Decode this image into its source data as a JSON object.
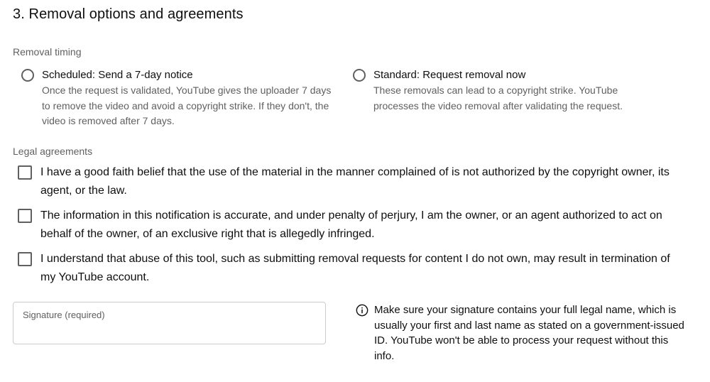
{
  "section": {
    "title": "3. Removal options and agreements"
  },
  "removal_timing": {
    "label": "Removal timing",
    "options": [
      {
        "title": "Scheduled: Send a 7-day notice",
        "description": "Once the request is validated, YouTube gives the uploader 7 days to remove the video and avoid a copyright strike. If they don't, the video is removed after 7 days.",
        "selected": false
      },
      {
        "title": "Standard: Request removal now",
        "description": "These removals can lead to a copyright strike. YouTube processes the video removal after validating the request.",
        "selected": false
      }
    ]
  },
  "legal_agreements": {
    "label": "Legal agreements",
    "items": [
      {
        "text": "I have a good faith belief that the use of the material in the manner complained of is not authorized by the copyright owner, its agent, or the law.",
        "checked": false
      },
      {
        "text": "The information in this notification is accurate, and under penalty of perjury, I am the owner, or an agent authorized to act on behalf of the owner, of an exclusive right that is allegedly infringed.",
        "checked": false
      },
      {
        "text": "I understand that abuse of this tool, such as submitting removal requests for content I do not own, may result in termination of my YouTube account.",
        "checked": false
      }
    ]
  },
  "signature": {
    "placeholder": "Signature (required)",
    "value": ""
  },
  "info_note": {
    "icon": "info-icon",
    "text": "Make sure your signature contains your full legal name, which is usually your first and last name as stated on a government-issued ID. YouTube won't be able to process your request without this info."
  },
  "colors": {
    "primary_text": "#0f0f0f",
    "secondary_text": "#606060",
    "border": "#cccccc"
  }
}
